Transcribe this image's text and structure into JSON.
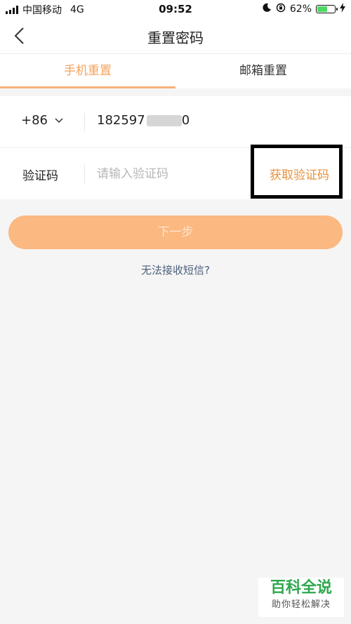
{
  "status_bar": {
    "carrier": "中国移动",
    "network": "4G",
    "time": "09:52",
    "battery": "62%",
    "battery_level": 0.62
  },
  "nav": {
    "title": "重置密码"
  },
  "tabs": [
    {
      "label": "手机重置",
      "active": true
    },
    {
      "label": "邮箱重置",
      "active": false
    }
  ],
  "form": {
    "country_code": "+86",
    "phone_number": "182597",
    "phone_tail": "0",
    "code_label": "验证码",
    "code_placeholder": "请输入验证码",
    "get_code_label": "获取验证码"
  },
  "next_label": "下一步",
  "help_link": "无法接收短信?",
  "watermark": {
    "title": "百科全说",
    "subtitle": "助你轻松解决"
  },
  "colors": {
    "accent": "#f5a25d",
    "button": "#fbb880",
    "highlight_border": "#000000"
  }
}
